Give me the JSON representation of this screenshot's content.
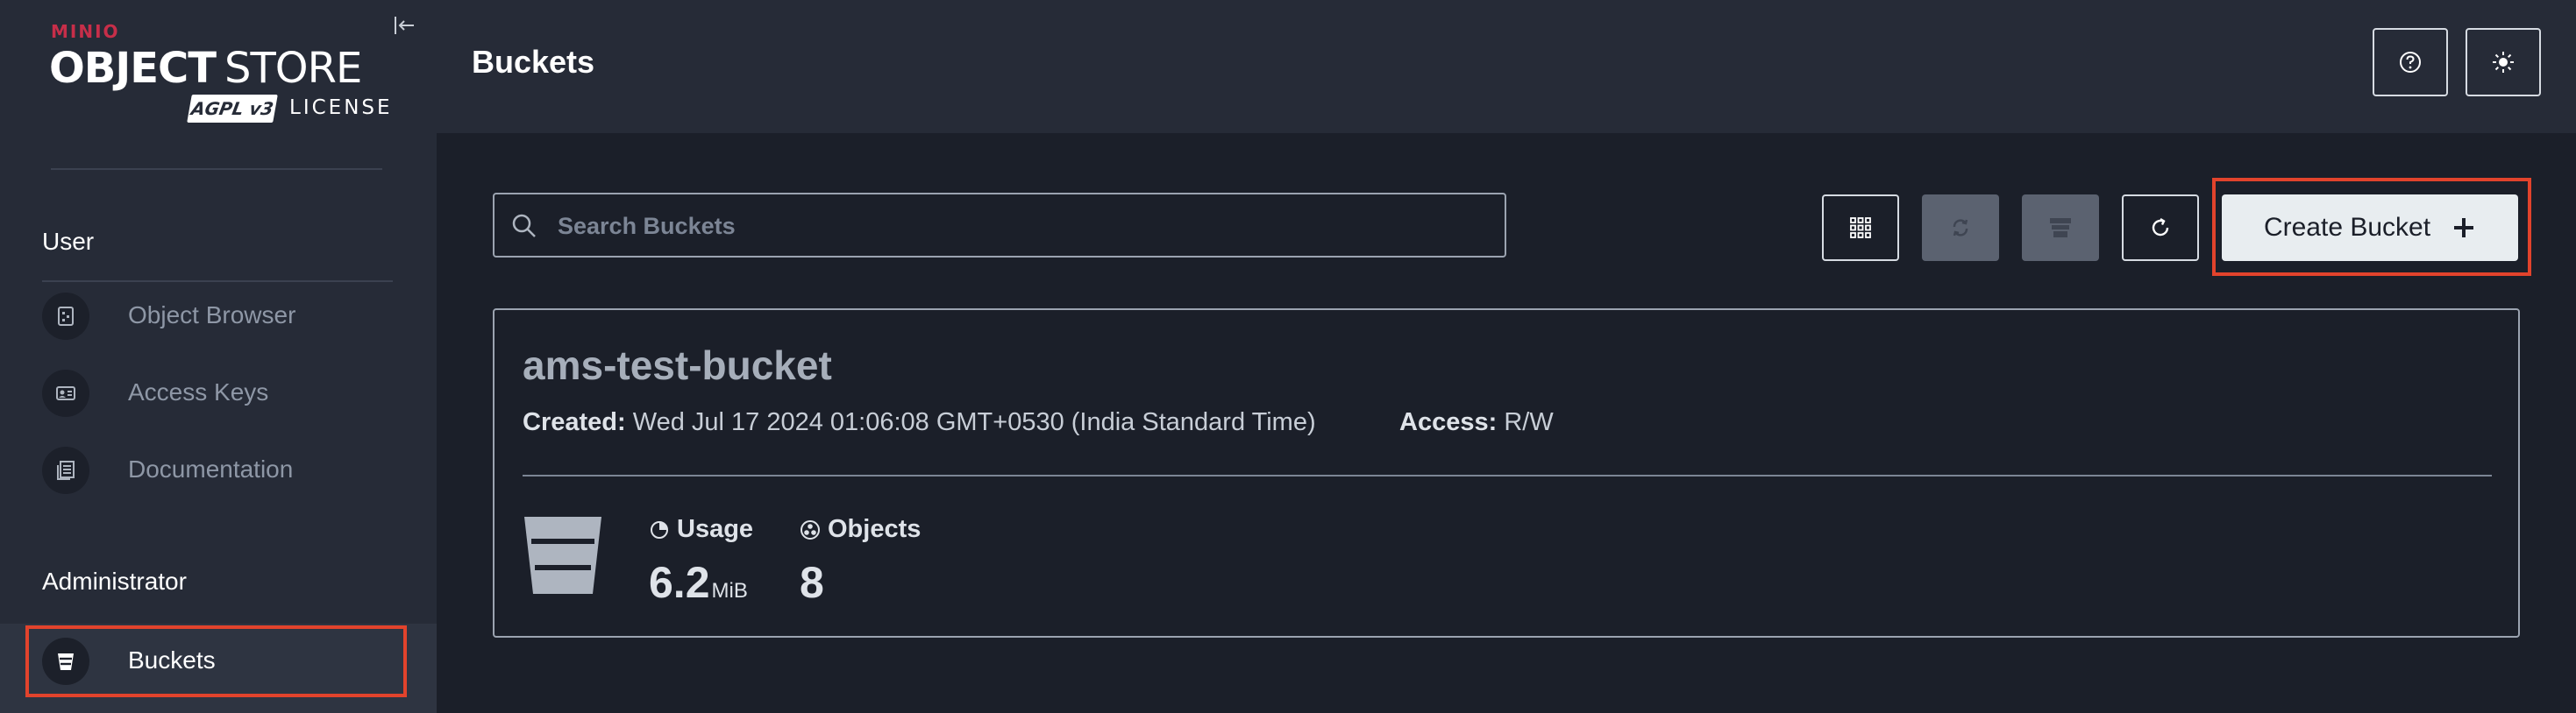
{
  "brand": {
    "vendor": "MINIO",
    "product_bold": "OBJECT",
    "product_light": "STORE",
    "license_badge": "AGPL v3",
    "license_text": "LICENSE"
  },
  "sidebar": {
    "user_section": "User",
    "user_items": [
      {
        "label": "Object Browser",
        "icon": "object-browser-icon"
      },
      {
        "label": "Access Keys",
        "icon": "access-keys-icon"
      },
      {
        "label": "Documentation",
        "icon": "documentation-icon"
      }
    ],
    "admin_section": "Administrator",
    "admin_items": [
      {
        "label": "Buckets",
        "icon": "bucket-icon",
        "active": true
      }
    ]
  },
  "header": {
    "title": "Buckets",
    "buttons": [
      "help-icon",
      "theme-toggle-icon"
    ]
  },
  "toolbar": {
    "search_placeholder": "Search Buckets",
    "search_value": "",
    "create_label": "Create Bucket"
  },
  "bucket": {
    "name": "ams-test-bucket",
    "created_label": "Created:",
    "created_value": "Wed Jul 17 2024 01:06:08 GMT+0530 (India Standard Time)",
    "access_label": "Access:",
    "access_value": "R/W",
    "usage_label": "Usage",
    "usage_value": "6.2",
    "usage_unit": "MiB",
    "objects_label": "Objects",
    "objects_value": "8"
  },
  "colors": {
    "accent_highlight": "#e2432c",
    "brand_red": "#c72e49",
    "sidebar_bg": "#262b37",
    "main_bg": "#1b1f29"
  }
}
